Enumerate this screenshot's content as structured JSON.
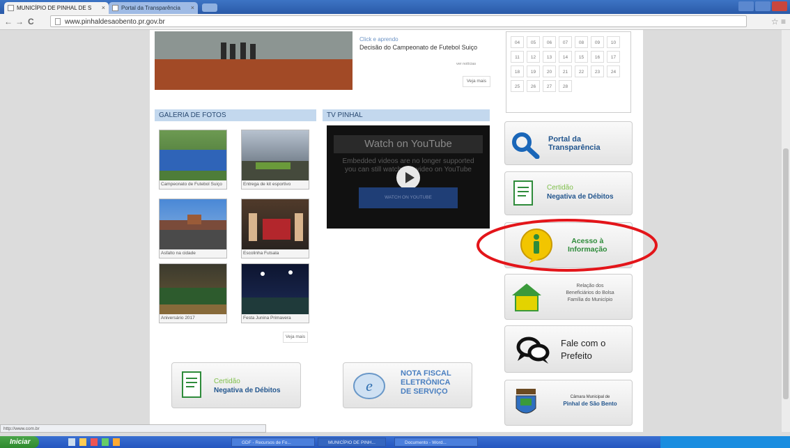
{
  "browser": {
    "tabs": [
      {
        "label": "MUNICÍPIO DE PINHAL DE S",
        "close": "×"
      },
      {
        "label": "Portal da Transparência",
        "close": "×"
      }
    ],
    "url": "www.pinhaldesaobento.pr.gov.br",
    "nav_back": "←",
    "nav_forward": "→",
    "nav_reload": "C",
    "status_url": "http://www.com.br"
  },
  "news": {
    "link_title": "Click e aprendo",
    "text": "Decisão do Campeonato de Futebol Suiço",
    "more_news": "ver notícias",
    "see_more": "Veja mais"
  },
  "calendar": {
    "days": [
      "04",
      "05",
      "06",
      "07",
      "08",
      "09",
      "10",
      "11",
      "12",
      "13",
      "14",
      "15",
      "16",
      "17",
      "18",
      "19",
      "20",
      "21",
      "22",
      "23",
      "24",
      "25",
      "26",
      "27",
      "28"
    ]
  },
  "gallery": {
    "header": "GALERIA DE FOTOS",
    "items": [
      {
        "caption": "Campeonato de Futebol Suiço"
      },
      {
        "caption": "Entrega de kit esportivo"
      },
      {
        "caption": "Asfalto na cidade"
      },
      {
        "caption": "Escolinha Futsala"
      },
      {
        "caption": "Aniversário 2017"
      },
      {
        "caption": "Festa Junina Primavera"
      }
    ],
    "see_more": "Veja mais"
  },
  "tv": {
    "header": "TV PINHAL",
    "watch": "Watch on YouTube",
    "msg1": "Embedded videos are no longer supported",
    "msg2": "you can still watch this video on YouTube",
    "button": "WATCH ON YOUTUBE"
  },
  "sidebar": {
    "portal": {
      "line1": "Portal da",
      "line2": "Transparência"
    },
    "certidao": {
      "line1": "Certidão",
      "line2": "Negativa de Débitos"
    },
    "acesso": {
      "line1": "Acesso à",
      "line2": "Informação"
    },
    "bolsa": {
      "line1": "Relação dos",
      "line2": "Beneficiários do Bolsa",
      "line3": "Família do Município"
    },
    "fale": {
      "line1": "Fale com o",
      "line2": "Prefeito"
    },
    "camara": {
      "line1": "Câmara Municipal de",
      "line2": "Pinhal de São Bento"
    }
  },
  "bottom": {
    "certidao": {
      "line1": "Certidão",
      "line2": "Negativa de Débitos"
    },
    "nota": {
      "line1": "NOTA FISCAL",
      "line2": "ELETRÔNICA",
      "line3": "DE SERVIÇO"
    }
  },
  "taskbar": {
    "start": "Iniciar",
    "tasks": [
      "GDF - Recursos de Fo...",
      "MUNICÍPIO DE PINH...",
      "Documento - Word..."
    ]
  },
  "colors": {
    "highlight_circle": "#e3151a",
    "accent_green": "#2e8b3a",
    "accent_blue": "#23568e"
  }
}
